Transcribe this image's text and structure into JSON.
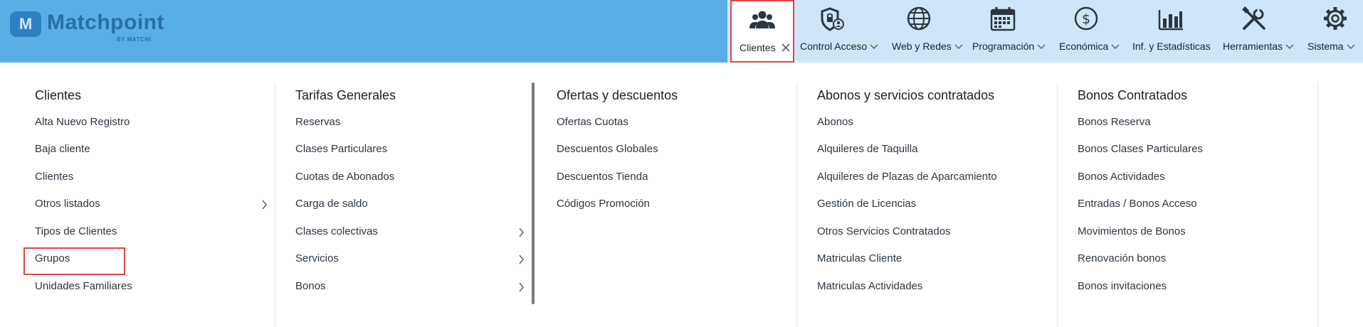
{
  "app": {
    "logo_text": "Matchpoint",
    "logo_badge": "M",
    "logo_sub": "BY MATCHI"
  },
  "nav": {
    "items": [
      {
        "label": "Clientes",
        "icon": "users-icon",
        "active": true
      },
      {
        "label": "Control Acceso",
        "icon": "shield-user-icon"
      },
      {
        "label": "Web y Redes",
        "icon": "globe-icon"
      },
      {
        "label": "Programación",
        "icon": "calendar-icon"
      },
      {
        "label": "Económica",
        "icon": "dollar-circle-icon"
      },
      {
        "label": "Inf. y Estadísticas",
        "icon": "bar-chart-icon"
      },
      {
        "label": "Herramientas",
        "icon": "tools-icon"
      },
      {
        "label": "Sistema",
        "icon": "gear-icon"
      }
    ]
  },
  "menu": {
    "columns": [
      {
        "title": "Clientes",
        "items": [
          {
            "label": "Alta Nuevo Registro"
          },
          {
            "label": "Baja cliente"
          },
          {
            "label": "Clientes"
          },
          {
            "label": "Otros listados",
            "submenu": true
          },
          {
            "label": "Tipos de Clientes"
          },
          {
            "label": "Grupos",
            "highlighted": true
          },
          {
            "label": "Unidades Familiares"
          }
        ]
      },
      {
        "title": "Tarifas Generales",
        "items": [
          {
            "label": "Reservas"
          },
          {
            "label": "Clases Particulares"
          },
          {
            "label": "Cuotas de Abonados"
          },
          {
            "label": "Carga de saldo"
          },
          {
            "label": "Clases colectivas",
            "submenu": true
          },
          {
            "label": "Servicios",
            "submenu": true
          },
          {
            "label": "Bonos",
            "submenu": true
          }
        ]
      },
      {
        "title": "Ofertas y descuentos",
        "items": [
          {
            "label": "Ofertas Cuotas"
          },
          {
            "label": "Descuentos Globales"
          },
          {
            "label": "Descuentos Tienda"
          },
          {
            "label": "Códigos Promoción"
          }
        ]
      },
      {
        "title": "Abonos y servicios contratados",
        "items": [
          {
            "label": "Abonos"
          },
          {
            "label": "Alquileres de Taquilla"
          },
          {
            "label": "Alquileres de Plazas de Aparcamiento"
          },
          {
            "label": "Gestión de Licencias"
          },
          {
            "label": "Otros Servicios Contratados"
          },
          {
            "label": "Matriculas Cliente"
          },
          {
            "label": "Matriculas Actividades"
          }
        ]
      },
      {
        "title": "Bonos Contratados",
        "items": [
          {
            "label": "Bonos Reserva"
          },
          {
            "label": "Bonos Clases Particulares"
          },
          {
            "label": "Bonos Actividades"
          },
          {
            "label": "Entradas / Bonos Acceso"
          },
          {
            "label": "Movimientos de Bonos"
          },
          {
            "label": "Renovación bonos"
          },
          {
            "label": "Bonos invitaciones"
          }
        ]
      }
    ]
  },
  "colors": {
    "topbar_left": "#5aaee6",
    "topbar_right": "#cfe6f8",
    "highlight": "#e04545"
  }
}
